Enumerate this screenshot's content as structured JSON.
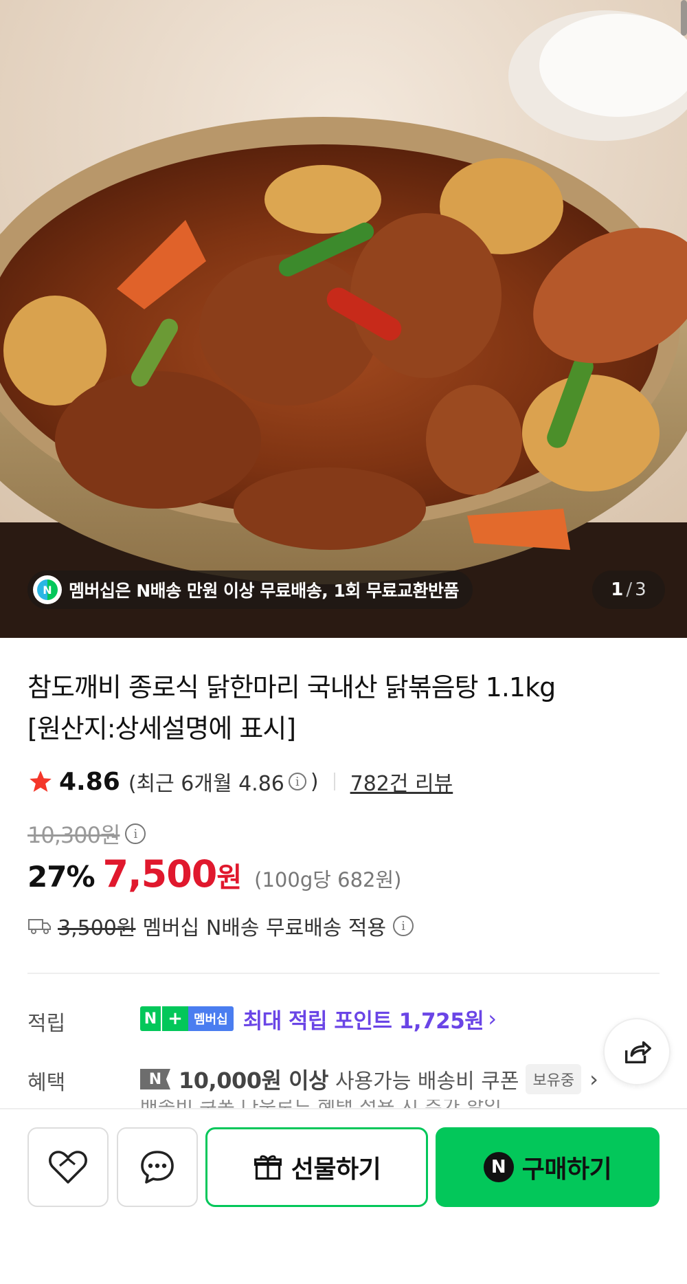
{
  "hero": {
    "image_alt": "",
    "promo_text": "멤버십은 N배송 만원 이상 무료배송, 1회 무료교환반품",
    "promo_icon": "membership-n-icon",
    "counter_current": "1",
    "counter_sep": "/",
    "counter_total": "3"
  },
  "product": {
    "title_line1": "참도깨비 종로식 닭한마리 국내산 닭볶음탕 1.1kg",
    "title_line2": "[원산지:상세설명에 표시]",
    "rating": "4.86",
    "rating_recent_open": "(최근 6개월 4.86",
    "rating_recent_close": ")",
    "review_count": "782건 리뷰",
    "original_price": "10,300원",
    "discount_rate": "27%",
    "sale_price": "7,500",
    "sale_currency": "원",
    "unit_price": "(100g당 682원)",
    "shipping_old": "3,500원",
    "shipping_text": "멤버십 N배송 무료배송 적용"
  },
  "benefits": {
    "points_label": "적립",
    "points_badge_n": "N",
    "points_badge_plus": "+",
    "points_badge_member": "멤버십",
    "points_text": "최대 적립 포인트 1,725원",
    "benefit_label": "혜택",
    "benefit_badge": "N",
    "benefit_strong": "10,000원 이상",
    "benefit_text": "사용가능 배송비 쿠폰",
    "benefit_held": "보유중",
    "cutoff_text": "배송비 쿠폰 다운로드 혜택 적용 시 추가 할인"
  },
  "bottom_bar": {
    "gift_label": "선물하기",
    "buy_label": "구매하기",
    "buy_badge": "N"
  },
  "colors": {
    "naver_green": "#03c75a",
    "sale_red": "#e0182d",
    "points_purple": "#6a45e6"
  }
}
